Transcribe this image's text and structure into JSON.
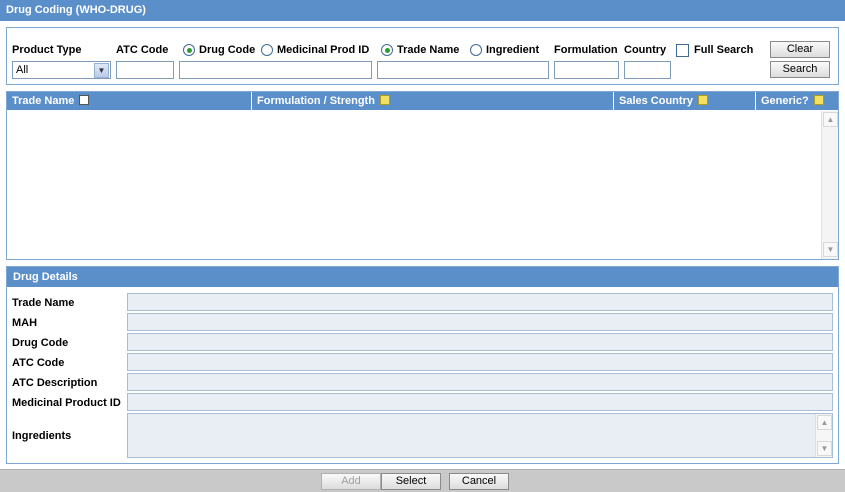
{
  "window": {
    "title": "Drug Coding (WHO-DRUG)"
  },
  "search": {
    "product_type_label": "Product Type",
    "product_type_value": "All",
    "atc_code_label": "ATC Code",
    "atc_code_value": "",
    "radio_drug_code": "Drug Code",
    "radio_medicinal_prod_id": "Medicinal Prod ID",
    "radio_trade_name": "Trade Name",
    "radio_ingredient": "Ingredient",
    "code_selected": "Drug Code",
    "name_selected": "Trade Name",
    "code_value": "",
    "name_value": "",
    "formulation_label": "Formulation",
    "formulation_value": "",
    "country_label": "Country",
    "country_value": "",
    "full_search_label": "Full Search",
    "full_search_checked": false,
    "clear_label": "Clear",
    "search_label": "Search"
  },
  "results": {
    "columns": [
      {
        "label": "Trade Name",
        "icon": "expand-box-icon"
      },
      {
        "label": "Formulation / Strength",
        "icon": "sort-icon"
      },
      {
        "label": "Sales Country",
        "icon": "sort-icon"
      },
      {
        "label": "Generic?",
        "icon": "sort-icon"
      }
    ],
    "rows": []
  },
  "details": {
    "header": "Drug Details",
    "fields": [
      {
        "label": "Trade Name",
        "value": ""
      },
      {
        "label": "MAH",
        "value": ""
      },
      {
        "label": "Drug Code",
        "value": ""
      },
      {
        "label": "ATC Code",
        "value": ""
      },
      {
        "label": "ATC Description",
        "value": ""
      },
      {
        "label": "Medicinal Product ID",
        "value": ""
      },
      {
        "label": "Ingredients",
        "value": ""
      }
    ]
  },
  "footer": {
    "add_label": "Add",
    "select_label": "Select",
    "cancel_label": "Cancel"
  },
  "colors": {
    "header_blue": "#5b8fc9",
    "radio_selected": "#2f9a2f",
    "readonly_field": "#e9eef5"
  }
}
